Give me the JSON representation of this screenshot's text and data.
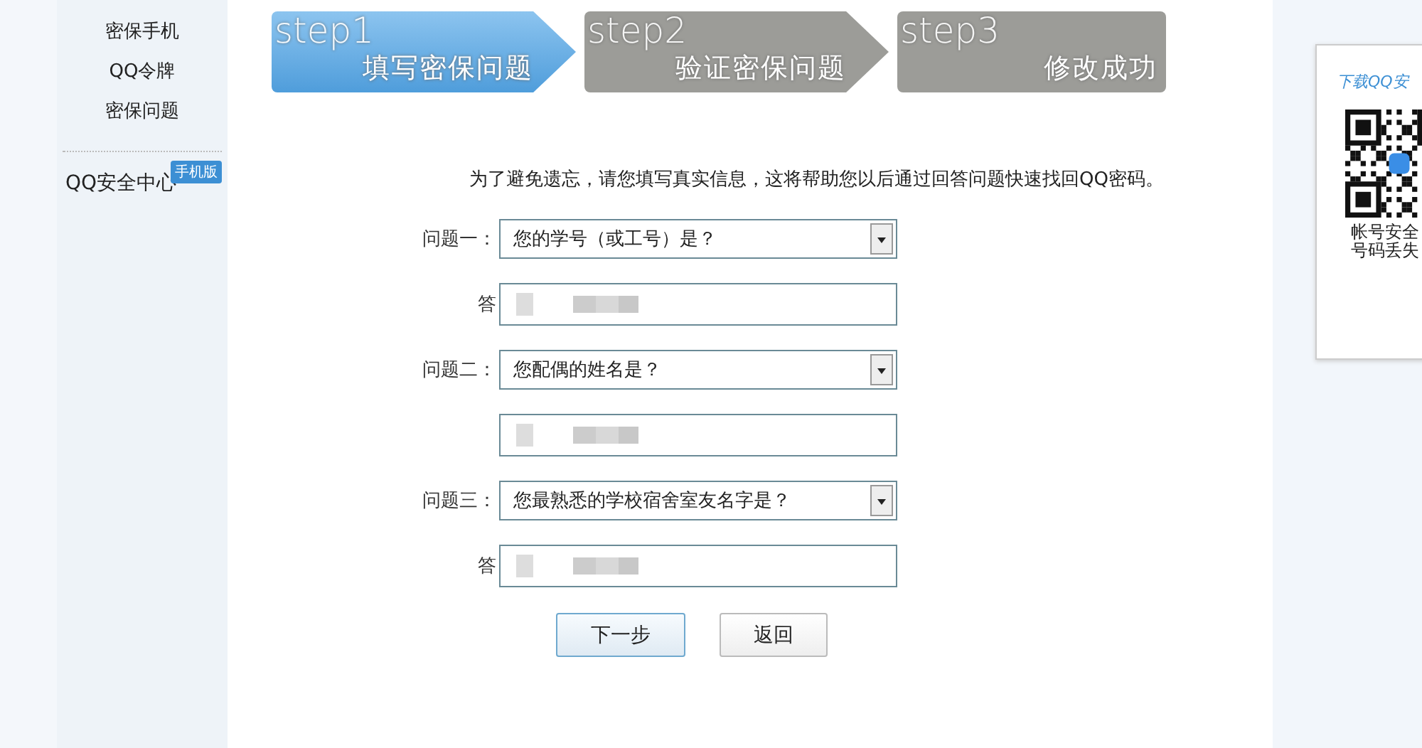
{
  "sidebar": {
    "items": [
      {
        "label": "密保手机"
      },
      {
        "label": "QQ令牌"
      },
      {
        "label": "密保问题"
      }
    ],
    "app_link": {
      "label": "QQ安全中心",
      "badge": "手机版"
    }
  },
  "steps": [
    {
      "step": "step1",
      "label": "填写密保问题",
      "selected": true,
      "arrow": true
    },
    {
      "step": "step2",
      "label": "验证密保问题",
      "selected": false,
      "arrow": true
    },
    {
      "step": "step3",
      "label": "修改成功",
      "selected": false,
      "arrow": false
    }
  ],
  "form": {
    "intro": "为了避免遗忘，请您填写真实信息，这将帮助您以后通过回答问题快速找回QQ密码。",
    "questions": [
      {
        "label": "问题一：",
        "value": "您的学号（或工号）是？",
        "answer_label": "答"
      },
      {
        "label": "问题二：",
        "value": "您配偶的姓名是？"
      },
      {
        "label": "问题三：",
        "value": "您最熟悉的学校宿舍室友名字是？",
        "answer_label": "答"
      }
    ],
    "buttons": [
      {
        "label": "下一步",
        "primary": true
      },
      {
        "label": "返回",
        "primary": false
      }
    ]
  },
  "side_panel": {
    "title": "下载QQ安",
    "caption": [
      "帐号安全",
      "号码丢失"
    ]
  }
}
